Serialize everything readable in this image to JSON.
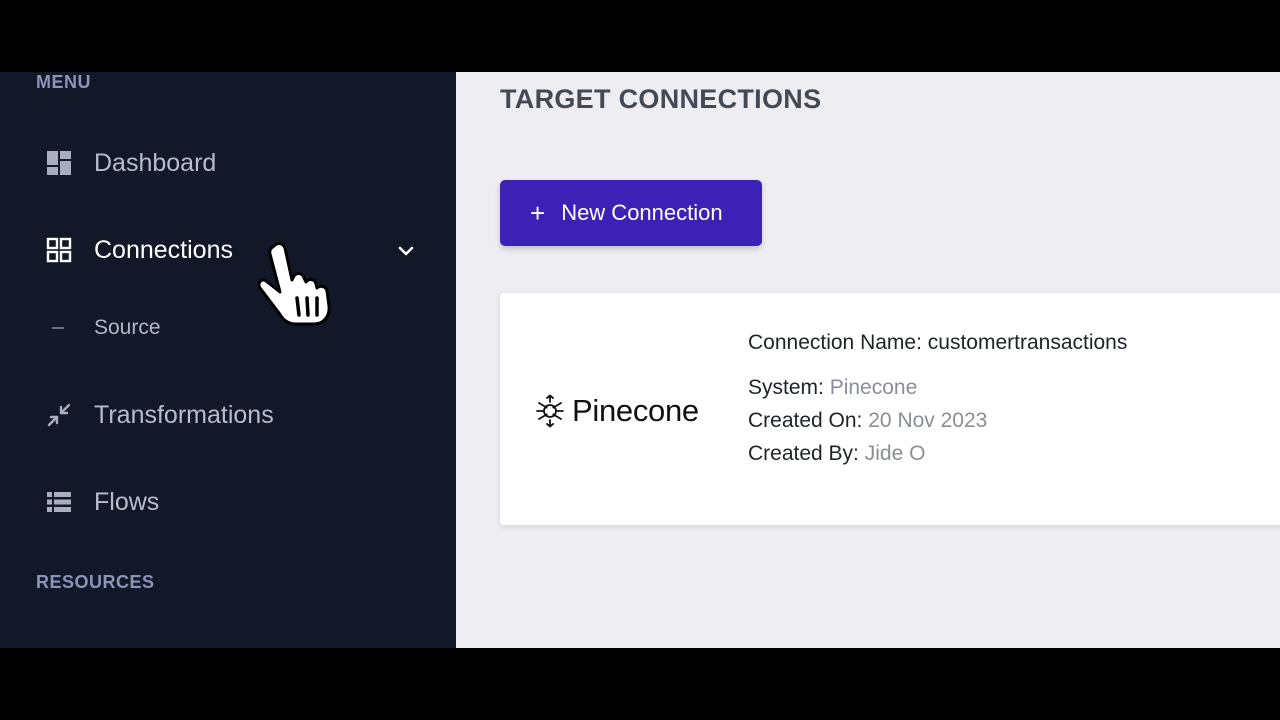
{
  "sidebar": {
    "menu_label": "MENU",
    "items": [
      {
        "label": "Dashboard",
        "icon": "dashboard-icon"
      },
      {
        "label": "Connections",
        "icon": "grid-icon",
        "expanded": true
      },
      {
        "label": "Transformations",
        "icon": "compress-arrows-icon"
      },
      {
        "label": "Flows",
        "icon": "list-icon"
      }
    ],
    "sub_items": [
      {
        "label": "Source"
      }
    ],
    "resources_label": "RESOURCES"
  },
  "main": {
    "title": "TARGET CONNECTIONS",
    "new_button": {
      "icon": "+",
      "label": "New Connection"
    },
    "connection": {
      "logo_text": "Pinecone",
      "name_label": "Connection Name:",
      "name_value": "customertransactions",
      "system_label": "System:",
      "system_value": "Pinecone",
      "created_on_label": "Created On:",
      "created_on_value": "20 Nov 2023",
      "created_by_label": "Created By:",
      "created_by_value": "Jide O"
    }
  },
  "colors": {
    "sidebar_bg": "#131829",
    "accent": "#3b21b5",
    "main_bg": "#eeeef2"
  }
}
